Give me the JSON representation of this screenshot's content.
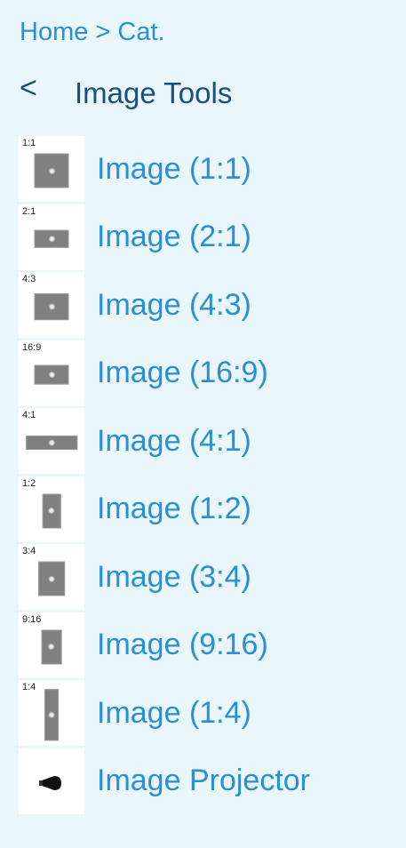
{
  "breadcrumb": {
    "home": "Home",
    "sep": ">",
    "current": "Cat."
  },
  "header": {
    "back": "<",
    "title": "Image Tools"
  },
  "items": [
    {
      "ratio": "1:1",
      "label": "Image (1:1)",
      "w": 1,
      "h": 1
    },
    {
      "ratio": "2:1",
      "label": "Image (2:1)",
      "w": 2,
      "h": 1
    },
    {
      "ratio": "4:3",
      "label": "Image (4:3)",
      "w": 4,
      "h": 3
    },
    {
      "ratio": "16:9",
      "label": "Image (16:9)",
      "w": 16,
      "h": 9
    },
    {
      "ratio": "4:1",
      "label": "Image (4:1)",
      "w": 4,
      "h": 1
    },
    {
      "ratio": "1:2",
      "label": "Image (1:2)",
      "w": 1,
      "h": 2
    },
    {
      "ratio": "3:4",
      "label": "Image (3:4)",
      "w": 3,
      "h": 4
    },
    {
      "ratio": "9:16",
      "label": "Image (9:16)",
      "w": 9,
      "h": 16
    },
    {
      "ratio": "1:4",
      "label": "Image (1:4)",
      "w": 1,
      "h": 4
    }
  ],
  "projector": {
    "label": "Image Projector",
    "icon": "projector-icon"
  }
}
